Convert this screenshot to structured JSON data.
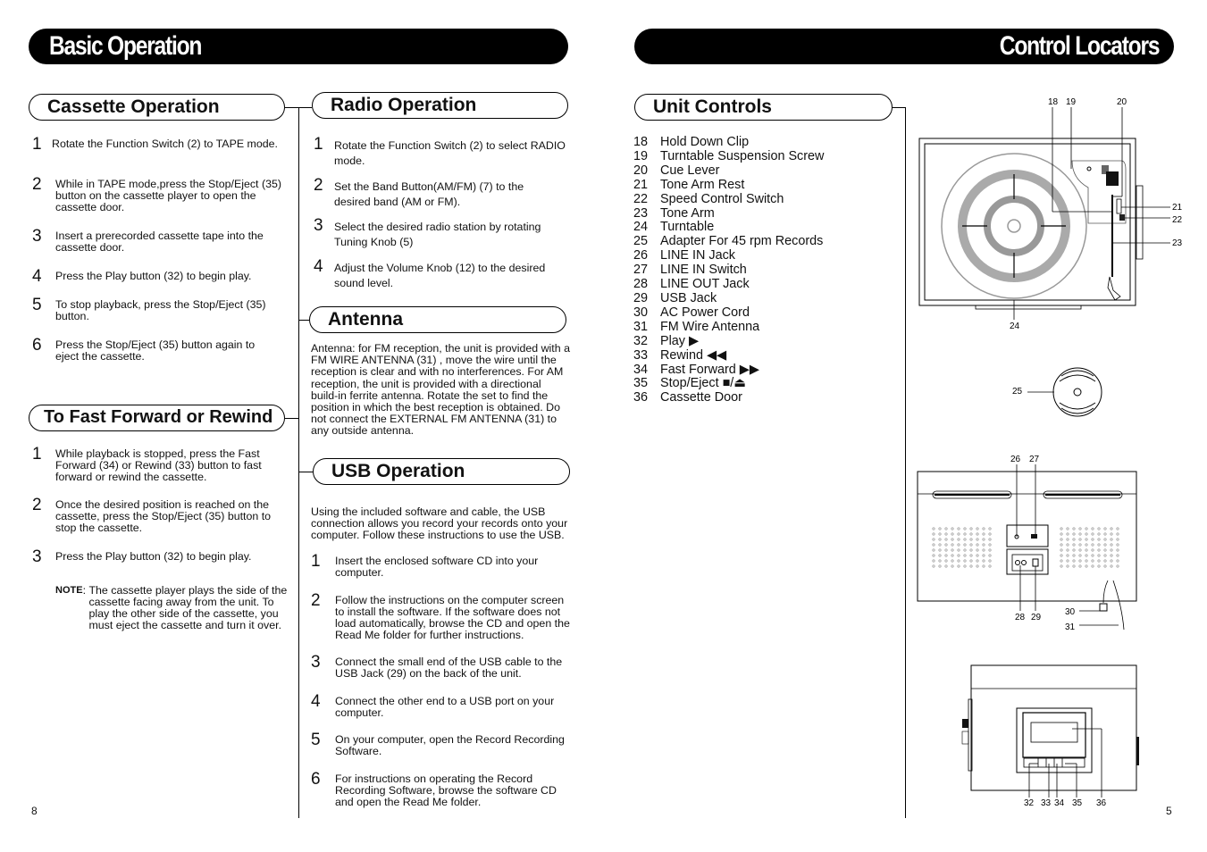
{
  "left_page": {
    "title": "Basic Operation",
    "page_number": "8",
    "cassette": {
      "heading": "Cassette Operation",
      "steps": [
        {
          "n": "1",
          "text": "Rotate the Function Switch (2) to TAPE mode."
        },
        {
          "n": "2",
          "text": "While in TAPE mode,press the Stop/Eject (35) button on the cassette player to open the cassette door."
        },
        {
          "n": "3",
          "text": "Insert a prerecorded cassette tape into the cassette door."
        },
        {
          "n": "4",
          "text": "Press the Play button (32) to begin play."
        },
        {
          "n": "5",
          "text": "To stop playback, press the Stop/Eject (35) button."
        },
        {
          "n": "6",
          "text": "Press the Stop/Eject (35) button again to eject the cassette."
        }
      ]
    },
    "ffrew": {
      "heading": "To Fast Forward or Rewind",
      "steps": [
        {
          "n": "1",
          "text": "While playback is stopped, press the Fast Forward (34) or Rewind (33) button to fast forward or rewind the cassette."
        },
        {
          "n": "2",
          "text": "Once the desired position is reached on the cassette, press the Stop/Eject (35) button to stop the cassette."
        },
        {
          "n": "3",
          "text": "Press the Play button (32) to begin play."
        }
      ],
      "note_label": "NOTE",
      "note_text": "The cassette player plays the side of the cassette facing away from the unit. To play the other side of the cassette, you must eject the cassette and turn it over."
    },
    "radio": {
      "heading": "Radio Operation",
      "steps": [
        {
          "n": "1",
          "text": "Rotate the Function Switch (2) to select RADIO mode."
        },
        {
          "n": "2",
          "text": "Set the Band Button(AM/FM) (7) to the desired band (AM or FM)."
        },
        {
          "n": "3",
          "text": "Select the desired radio station by rotating Tuning Knob (5)"
        },
        {
          "n": "4",
          "text": "Adjust the Volume Knob (12) to the desired sound level."
        }
      ]
    },
    "antenna": {
      "heading": "Antenna",
      "text": "Antenna: for FM reception, the unit is provided with a FM WIRE ANTENNA (31) , move the wire until the reception is clear and with no interferences. For AM reception, the unit is provided with a directional build-in ferrite antenna. Rotate the set to find the position in which the best reception is obtained. Do not connect the EXTERNAL FM ANTENNA (31) to any outside antenna."
    },
    "usb": {
      "heading": "USB Operation",
      "intro": "Using the included software and cable, the USB connection allows you record your records onto your computer. Follow these instructions to use the USB.",
      "steps": [
        {
          "n": "1",
          "text": "Insert the enclosed software CD into your computer."
        },
        {
          "n": "2",
          "text": "Follow the instructions on the computer screen to install the software. If the software does not load automatically, browse the CD and open the Read Me folder for further instructions."
        },
        {
          "n": "3",
          "text": "Connect the small end of the USB cable to the USB Jack (29) on the back of the unit."
        },
        {
          "n": "4",
          "text": "Connect the other end to a USB port on your computer."
        },
        {
          "n": "5",
          "text": "On your computer, open the Record Recording Software."
        },
        {
          "n": "6",
          "text": "For instructions on operating the Record Recording Software, browse the software CD and open the Read Me folder."
        }
      ]
    }
  },
  "right_page": {
    "title": "Control Locators",
    "page_number": "5",
    "unit_controls": {
      "heading": "Unit Controls",
      "items": [
        {
          "n": "18",
          "label": "Hold Down Clip"
        },
        {
          "n": "19",
          "label": "Turntable Suspension Screw"
        },
        {
          "n": "20",
          "label": "Cue Lever"
        },
        {
          "n": "21",
          "label": "Tone Arm Rest"
        },
        {
          "n": "22",
          "label": "Speed Control Switch"
        },
        {
          "n": "23",
          "label": "Tone Arm"
        },
        {
          "n": "24",
          "label": "Turntable"
        },
        {
          "n": "25",
          "label": "Adapter For 45 rpm Records"
        },
        {
          "n": "26",
          "label": "LINE IN Jack"
        },
        {
          "n": "27",
          "label": "LINE IN Switch"
        },
        {
          "n": "28",
          "label": "LINE OUT Jack"
        },
        {
          "n": "29",
          "label": "USB Jack"
        },
        {
          "n": "30",
          "label": "AC Power Cord"
        },
        {
          "n": "31",
          "label": "FM Wire Antenna"
        },
        {
          "n": "32",
          "label": "Play ▶"
        },
        {
          "n": "33",
          "label": "Rewind ◀◀"
        },
        {
          "n": "34",
          "label": "Fast Forward ▶▶"
        },
        {
          "n": "35",
          "label": "Stop/Eject ■/⏏"
        },
        {
          "n": "36",
          "label": "Cassette Door"
        }
      ]
    },
    "diagrams": {
      "top_view_callouts": [
        "18",
        "19",
        "20",
        "21",
        "22",
        "23",
        "24"
      ],
      "adapter_callout": "25",
      "rear_view_callouts": [
        "26",
        "27",
        "28",
        "29",
        "30",
        "31"
      ],
      "side_view_callouts": [
        "32",
        "33",
        "34",
        "35",
        "36"
      ]
    }
  }
}
